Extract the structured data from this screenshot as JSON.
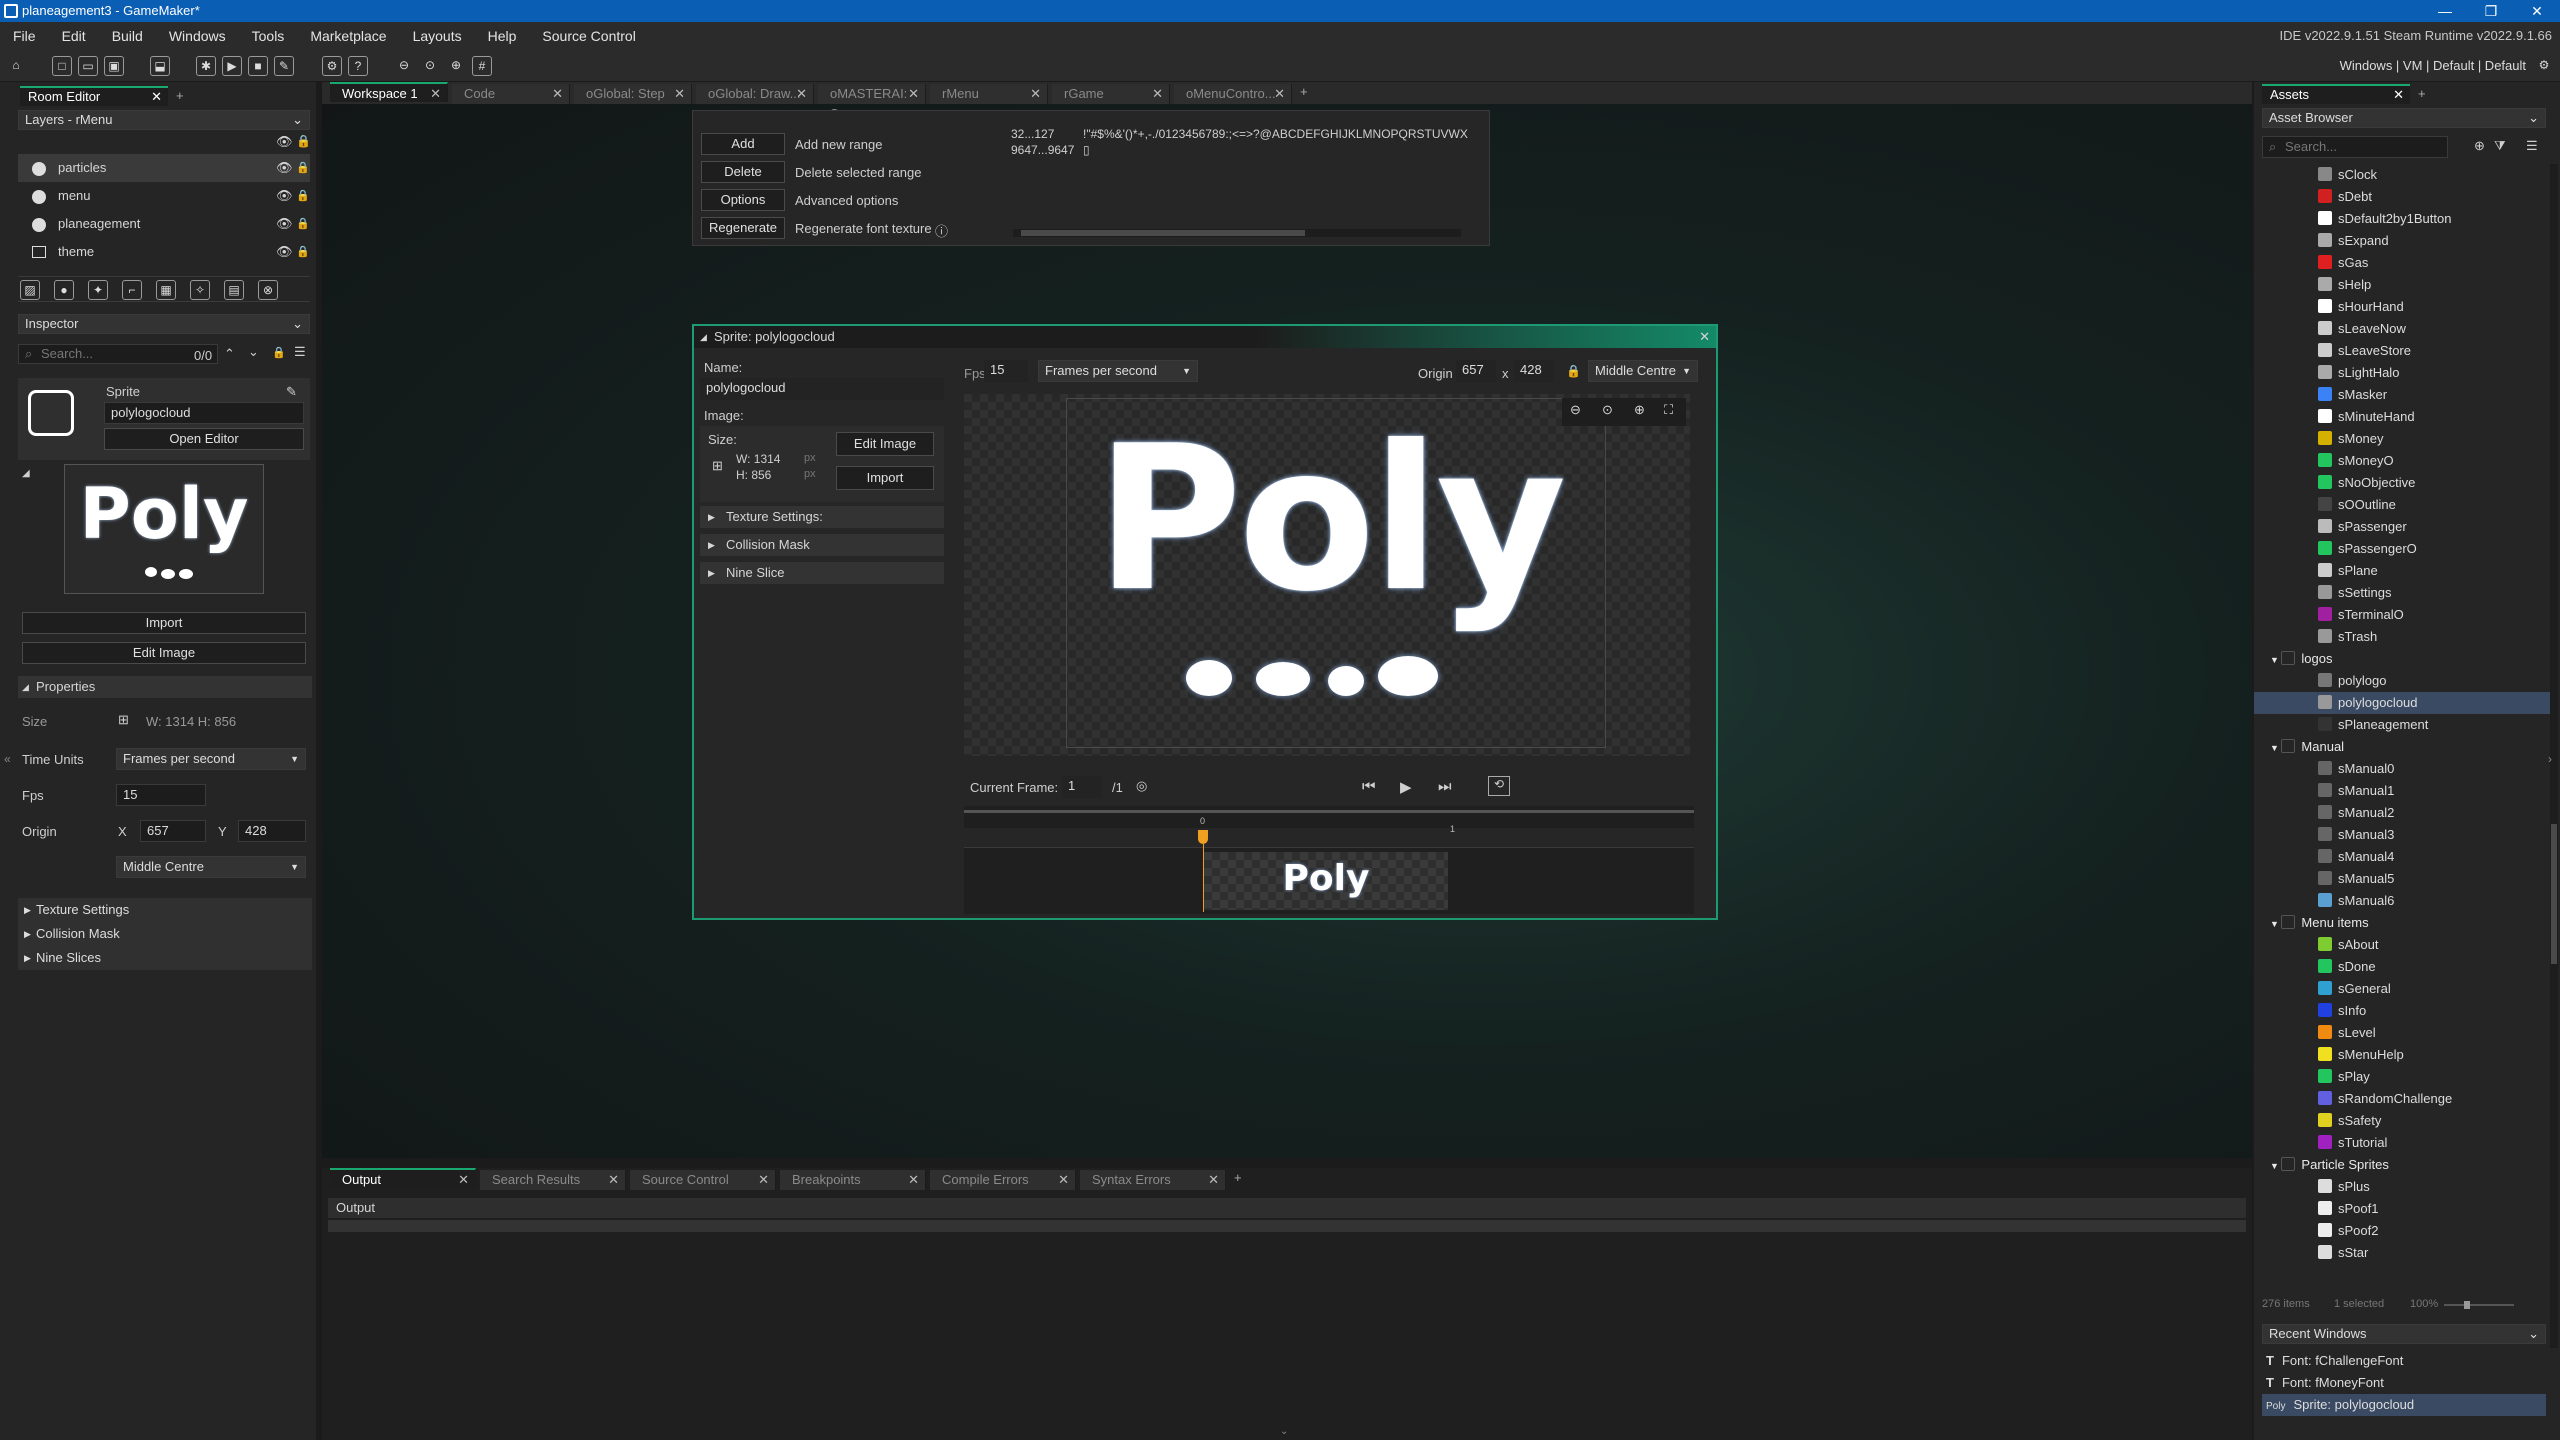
{
  "window": {
    "title": "planeagement3 - GameMaker*",
    "controls": [
      "—",
      "❐",
      "✕"
    ]
  },
  "menubar": {
    "items": [
      "File",
      "Edit",
      "Build",
      "Windows",
      "Tools",
      "Marketplace",
      "Layouts",
      "Help",
      "Source Control"
    ],
    "ide_version": "IDE v2022.9.1.51 Steam  Runtime v2022.9.1.66"
  },
  "toolbar": {
    "targets": "Windows | VM | Default | Default"
  },
  "left": {
    "room_tab": "Room Editor",
    "layers_dropdown": "Layers - rMenu",
    "layers": [
      {
        "name": "particles"
      },
      {
        "name": "menu"
      },
      {
        "name": "planeagement"
      },
      {
        "name": "theme"
      }
    ],
    "inspector_title": "Inspector",
    "search_placeholder": "Search...",
    "search_count": "0/0",
    "sprite_label": "Sprite",
    "sprite_name": "polylogocloud",
    "open_editor": "Open Editor",
    "preview_text": "Poly",
    "import": "Import",
    "edit_image": "Edit Image",
    "properties": "Properties",
    "size_label": "Size",
    "size_value": "W: 1314  H: 856",
    "time_units_label": "Time Units",
    "time_units_value": "Frames per second",
    "fps_label": "Fps",
    "fps_value": "15",
    "origin_label": "Origin",
    "origin_x_label": "X",
    "origin_x": "657",
    "origin_y_label": "Y",
    "origin_y": "428",
    "origin_mode": "Middle Centre",
    "sections": [
      "Texture Settings",
      "Collision Mask",
      "Nine Slices"
    ]
  },
  "tabs": [
    "Workspace 1",
    "Code",
    "oGlobal: Step",
    "oGlobal: Draw...",
    "oMASTERAI: S...",
    "rMenu",
    "rGame",
    "oMenuContro..."
  ],
  "font_panel": {
    "buttons": [
      {
        "btn": "Add",
        "desc": "Add new range"
      },
      {
        "btn": "Delete",
        "desc": "Delete selected range"
      },
      {
        "btn": "Options",
        "desc": "Advanced options"
      },
      {
        "btn": "Regenerate",
        "desc": "Regenerate font texture"
      }
    ],
    "range_a": "32...127",
    "range_a_chars": "!\"#$%&'()*+,-./0123456789:;<=>?@ABCDEFGHIJKLMNOPQRSTUVWX",
    "range_b": "9647...9647",
    "range_b_chars": "▯"
  },
  "sprite_editor": {
    "title": "Sprite: polylogocloud",
    "name_label": "Name:",
    "name_value": "polylogocloud",
    "image_label": "Image:",
    "size_label": "Size:",
    "w": "W: 1314",
    "h": "H: 856",
    "px": "px",
    "edit_image": "Edit Image",
    "import": "Import",
    "sections": [
      "Texture Settings:",
      "Collision Mask",
      "Nine Slice"
    ],
    "fps_label": "Fps",
    "fps_value": "15",
    "fps_mode": "Frames per second",
    "origin_label": "Origin",
    "origin_x": "657",
    "x_sep": "x",
    "origin_y": "428",
    "origin_mode": "Middle Centre",
    "canvas_text": "Poly",
    "current_frame_label": "Current Frame:",
    "current_frame": "1",
    "frame_total": "/1",
    "timeline_marker": "0",
    "timeline_tick": "1",
    "thumb_text": "Poly"
  },
  "bottom": {
    "tabs": [
      "Output",
      "Search Results",
      "Source Control",
      "Breakpoints",
      "Compile Errors",
      "Syntax Errors"
    ],
    "output_header": "Output"
  },
  "assets": {
    "tab": "Assets",
    "browser": "Asset Browser",
    "search_placeholder": "Search...",
    "items": [
      {
        "name": "sClock",
        "color": "#888888",
        "grp": false,
        "indent": 2
      },
      {
        "name": "sDebt",
        "color": "#d02020",
        "grp": false,
        "indent": 2
      },
      {
        "name": "sDefault2by1Button",
        "color": "#ffffff",
        "grp": false,
        "indent": 2
      },
      {
        "name": "sExpand",
        "color": "#aaaaaa",
        "grp": false,
        "indent": 2
      },
      {
        "name": "sGas",
        "color": "#e02020",
        "grp": false,
        "indent": 2
      },
      {
        "name": "sHelp",
        "color": "#aaaaaa",
        "grp": false,
        "indent": 2
      },
      {
        "name": "sHourHand",
        "color": "#ffffff",
        "grp": false,
        "indent": 2
      },
      {
        "name": "sLeaveNow",
        "color": "#cccccc",
        "grp": false,
        "indent": 2
      },
      {
        "name": "sLeaveStore",
        "color": "#cccccc",
        "grp": false,
        "indent": 2
      },
      {
        "name": "sLightHalo",
        "color": "#aaaaaa",
        "grp": false,
        "indent": 2
      },
      {
        "name": "sMasker",
        "color": "#3b82f6",
        "grp": false,
        "indent": 2
      },
      {
        "name": "sMinuteHand",
        "color": "#ffffff",
        "grp": false,
        "indent": 2
      },
      {
        "name": "sMoney",
        "color": "#d4b000",
        "grp": false,
        "indent": 2
      },
      {
        "name": "sMoneyO",
        "color": "#22c55e",
        "grp": false,
        "indent": 2
      },
      {
        "name": "sNoObjective",
        "color": "#22c55e",
        "grp": false,
        "indent": 2
      },
      {
        "name": "sOOutline",
        "color": "#444444",
        "grp": false,
        "indent": 2
      },
      {
        "name": "sPassenger",
        "color": "#bbbbbb",
        "grp": false,
        "indent": 2
      },
      {
        "name": "sPassengerO",
        "color": "#22c55e",
        "grp": false,
        "indent": 2
      },
      {
        "name": "sPlane",
        "color": "#cccccc",
        "grp": false,
        "indent": 2
      },
      {
        "name": "sSettings",
        "color": "#999999",
        "grp": false,
        "indent": 2
      },
      {
        "name": "sTerminalO",
        "color": "#a020a0",
        "grp": false,
        "indent": 2
      },
      {
        "name": "sTrash",
        "color": "#999999",
        "grp": false,
        "indent": 2
      },
      {
        "name": "logos",
        "color": "#555555",
        "grp": true,
        "indent": 1
      },
      {
        "name": "polylogo",
        "color": "#777777",
        "grp": false,
        "indent": 2
      },
      {
        "name": "polylogocloud",
        "color": "#999999",
        "grp": false,
        "indent": 2,
        "selected": true
      },
      {
        "name": "sPlaneagement",
        "color": "#333333",
        "grp": false,
        "indent": 2
      },
      {
        "name": "Manual",
        "color": "#555555",
        "grp": true,
        "indent": 1
      },
      {
        "name": "sManual0",
        "color": "#666666",
        "grp": false,
        "indent": 2
      },
      {
        "name": "sManual1",
        "color": "#666666",
        "grp": false,
        "indent": 2
      },
      {
        "name": "sManual2",
        "color": "#666666",
        "grp": false,
        "indent": 2
      },
      {
        "name": "sManual3",
        "color": "#666666",
        "grp": false,
        "indent": 2
      },
      {
        "name": "sManual4",
        "color": "#666666",
        "grp": false,
        "indent": 2
      },
      {
        "name": "sManual5",
        "color": "#666666",
        "grp": false,
        "indent": 2
      },
      {
        "name": "sManual6",
        "color": "#5aa0d0",
        "grp": false,
        "indent": 2
      },
      {
        "name": "Menu items",
        "color": "#555555",
        "grp": true,
        "indent": 1
      },
      {
        "name": "sAbout",
        "color": "#7fcc30",
        "grp": false,
        "indent": 2
      },
      {
        "name": "sDone",
        "color": "#22c55e",
        "grp": false,
        "indent": 2
      },
      {
        "name": "sGeneral",
        "color": "#30a0d0",
        "grp": false,
        "indent": 2
      },
      {
        "name": "sInfo",
        "color": "#2040e0",
        "grp": false,
        "indent": 2
      },
      {
        "name": "sLevel",
        "color": "#f08a10",
        "grp": false,
        "indent": 2
      },
      {
        "name": "sMenuHelp",
        "color": "#f0e020",
        "grp": false,
        "indent": 2
      },
      {
        "name": "sPlay",
        "color": "#22c55e",
        "grp": false,
        "indent": 2
      },
      {
        "name": "sRandomChallenge",
        "color": "#6060e0",
        "grp": false,
        "indent": 2
      },
      {
        "name": "sSafety",
        "color": "#e0d020",
        "grp": false,
        "indent": 2
      },
      {
        "name": "sTutorial",
        "color": "#a020c0",
        "grp": false,
        "indent": 2
      },
      {
        "name": "Particle Sprites",
        "color": "#555555",
        "grp": true,
        "indent": 1
      },
      {
        "name": "sPlus",
        "color": "#dddddd",
        "grp": false,
        "indent": 2
      },
      {
        "name": "sPoof1",
        "color": "#eeeeee",
        "grp": false,
        "indent": 2
      },
      {
        "name": "sPoof2",
        "color": "#eeeeee",
        "grp": false,
        "indent": 2
      },
      {
        "name": "sStar",
        "color": "#dddddd",
        "grp": false,
        "indent": 2
      }
    ],
    "footer_count": "276 items",
    "footer_selected": "1 selected",
    "footer_zoom": "100%"
  },
  "recent": {
    "title": "Recent Windows",
    "items": [
      "Font: fChallengeFont",
      "Font: fMoneyFont",
      "Sprite: polylogocloud"
    ]
  }
}
